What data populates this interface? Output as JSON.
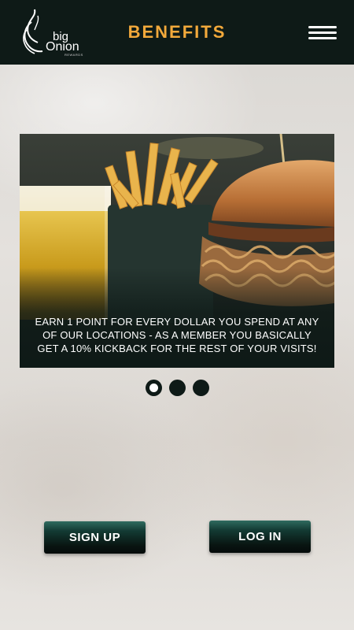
{
  "header": {
    "title": "BENEFITS",
    "logo": {
      "line1": "big",
      "line2": "Onion",
      "line3": "REWARDS",
      "icon": "onion-logo-icon"
    },
    "menu_icon": "hamburger-menu-icon"
  },
  "carousel": {
    "caption": "EARN 1 POINT FOR EVERY DOLLAR YOU SPEND AT ANY OF OUR LOCATIONS - AS A MEMBER YOU BASICALLY GET A 10% KICKBACK FOR THE REST OF YOUR VISITS!",
    "slide_count": 3,
    "active_index": 0,
    "image_subject": "burger-fries-beer"
  },
  "actions": {
    "signup_label": "SIGN UP",
    "login_label": "LOG IN"
  },
  "colors": {
    "header_bg": "#0e1a17",
    "title": "#f2a93b",
    "button_dark": "#091512",
    "button_highlight": "#2f6b5f"
  }
}
